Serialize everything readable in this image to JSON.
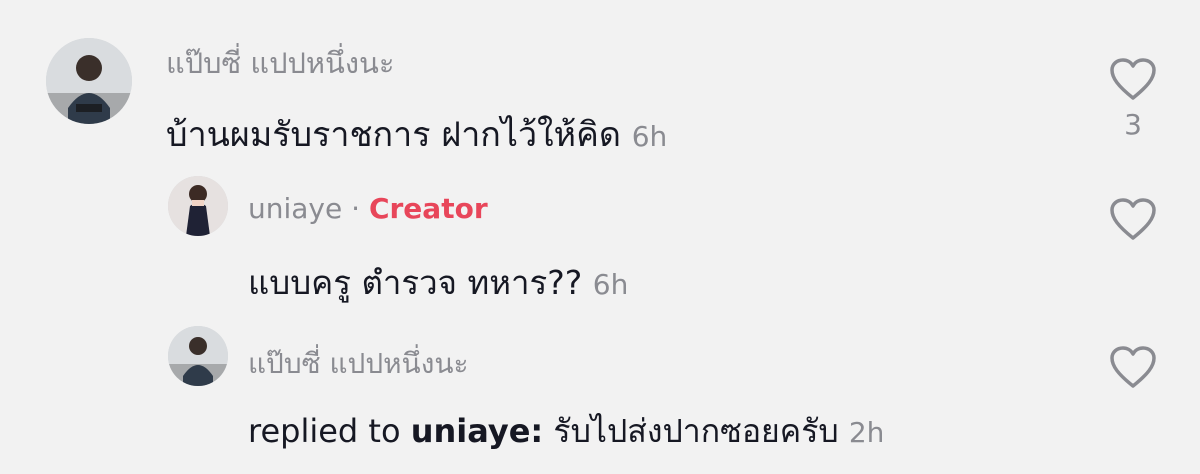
{
  "comments": [
    {
      "username": "แป๊บซี่ แปปหนึ่งนะ",
      "text": "บ้านผมรับราชการ ฝากไว้ให้คิด",
      "time": "6h",
      "like_count": "3",
      "icons": {
        "avatar": "avatar-photo",
        "like": "heart-outline-icon"
      }
    },
    {
      "username": "uniaye",
      "separator": "·",
      "badge": "Creator",
      "text": "แบบครู ตำรวจ ทหาร??",
      "time": "6h",
      "icons": {
        "avatar": "avatar-photo",
        "like": "heart-outline-icon"
      }
    },
    {
      "username": "แป๊บซี่ แปปหนึ่งนะ",
      "reply_prefix": "replied to",
      "reply_target": "uniaye:",
      "text": "รับไปส่งปากซอยครับ",
      "time": "2h",
      "icons": {
        "avatar": "avatar-photo",
        "like": "heart-outline-icon"
      }
    }
  ],
  "colors": {
    "background": "#f2f2f2",
    "username": "#8a8b91",
    "text": "#161823",
    "creator_badge": "#e8465a"
  }
}
